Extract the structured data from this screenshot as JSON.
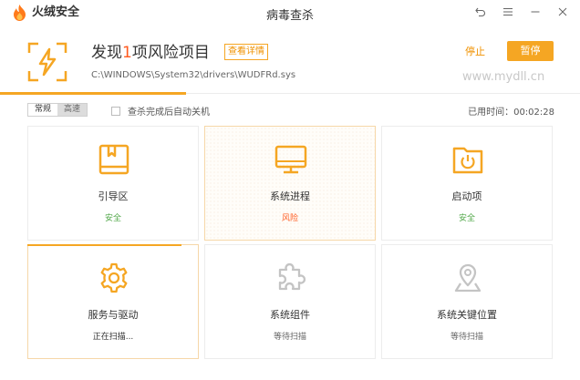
{
  "app": {
    "name": "火绒安全",
    "window_title": "病毒查杀"
  },
  "header": {
    "title_prefix": "发现",
    "risk_count": "1",
    "title_suffix": "项风险项目",
    "detail_label": "查看详情",
    "scan_path": "C:\\WINDOWS\\System32\\drivers\\WUDFRd.sys",
    "stop_label": "停止",
    "pause_label": "暂停",
    "watermark": "www.mydll.cn"
  },
  "progress": {
    "overall_fraction": 0.32
  },
  "options": {
    "mode_normal": "常规",
    "mode_fast": "高速",
    "auto_shutdown_label": "查杀完成后自动关机",
    "auto_shutdown_checked": false,
    "elapsed_label": "已用时间：",
    "elapsed_value": "00:02:28"
  },
  "cards": [
    {
      "name": "引导区",
      "status": "安全",
      "icon": "book-icon",
      "state": "safe"
    },
    {
      "name": "系统进程",
      "status": "风险",
      "icon": "monitor-icon",
      "state": "risk"
    },
    {
      "name": "启动项",
      "status": "安全",
      "icon": "power-folder-icon",
      "state": "safe"
    },
    {
      "name": "服务与驱动",
      "status": "正在扫描...",
      "icon": "gear-icon",
      "state": "scanning",
      "progress_fraction": 0.9
    },
    {
      "name": "系统组件",
      "status": "等待扫描",
      "icon": "puzzle-icon",
      "state": "waiting"
    },
    {
      "name": "系统关键位置",
      "status": "等待扫描",
      "icon": "location-pin-icon",
      "state": "waiting"
    }
  ],
  "colors": {
    "accent": "#f5a623",
    "risk": "#ff5a1f",
    "safe": "#52a84a",
    "inactive_icon": "#c4c4c4"
  }
}
